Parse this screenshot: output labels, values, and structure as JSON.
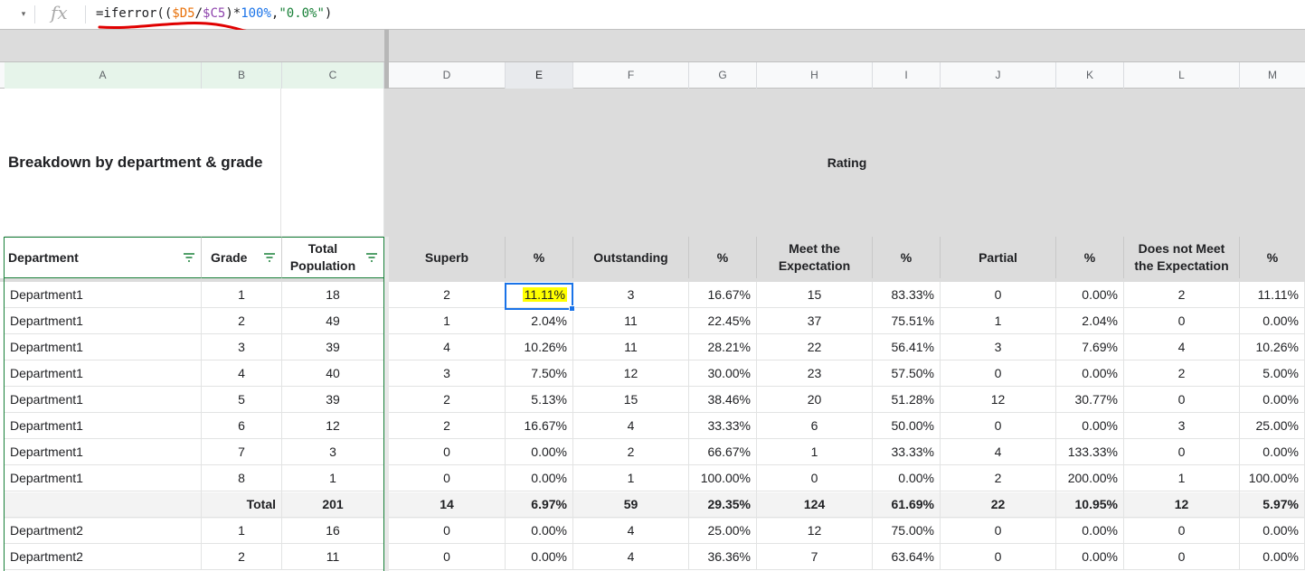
{
  "formula_bar": {
    "formula_prefix": "=iferror((",
    "ref1": "$D5",
    "slash": "/",
    "ref2": "$C5",
    "mid": ")*",
    "num": "100%",
    "comma": ",",
    "str": "\"0.0%\"",
    "suffix": ")"
  },
  "columns": [
    "A",
    "B",
    "C",
    "D",
    "E",
    "F",
    "G",
    "H",
    "I",
    "J",
    "K",
    "L",
    "M"
  ],
  "title": "Breakdown by department & grade",
  "rating_title": "Rating",
  "headers": {
    "department": "Department",
    "grade": "Grade",
    "total_population": "Total Population",
    "superb": "Superb",
    "pct1": "%",
    "outstanding": "Outstanding",
    "pct2": "%",
    "meet": "Meet the Expectation",
    "pct3": "%",
    "partial": "Partial",
    "pct4": "%",
    "does_not_meet": "Does not Meet the Expectation",
    "pct5": "%"
  },
  "rows": [
    [
      "Department1",
      "1",
      "18",
      "2",
      "11.11%",
      "3",
      "16.67%",
      "15",
      "83.33%",
      "0",
      "0.00%",
      "2",
      "11.11%"
    ],
    [
      "Department1",
      "2",
      "49",
      "1",
      "2.04%",
      "11",
      "22.45%",
      "37",
      "75.51%",
      "1",
      "2.04%",
      "0",
      "0.00%"
    ],
    [
      "Department1",
      "3",
      "39",
      "4",
      "10.26%",
      "11",
      "28.21%",
      "22",
      "56.41%",
      "3",
      "7.69%",
      "4",
      "10.26%"
    ],
    [
      "Department1",
      "4",
      "40",
      "3",
      "7.50%",
      "12",
      "30.00%",
      "23",
      "57.50%",
      "0",
      "0.00%",
      "2",
      "5.00%"
    ],
    [
      "Department1",
      "5",
      "39",
      "2",
      "5.13%",
      "15",
      "38.46%",
      "20",
      "51.28%",
      "12",
      "30.77%",
      "0",
      "0.00%"
    ],
    [
      "Department1",
      "6",
      "12",
      "2",
      "16.67%",
      "4",
      "33.33%",
      "6",
      "50.00%",
      "0",
      "0.00%",
      "3",
      "25.00%"
    ],
    [
      "Department1",
      "7",
      "3",
      "0",
      "0.00%",
      "2",
      "66.67%",
      "1",
      "33.33%",
      "4",
      "133.33%",
      "0",
      "0.00%"
    ],
    [
      "Department1",
      "8",
      "1",
      "0",
      "0.00%",
      "1",
      "100.00%",
      "0",
      "0.00%",
      "2",
      "200.00%",
      "1",
      "100.00%"
    ],
    [
      "",
      "Total",
      "201",
      "14",
      "6.97%",
      "59",
      "29.35%",
      "124",
      "61.69%",
      "22",
      "10.95%",
      "12",
      "5.97%"
    ],
    [
      "Department2",
      "1",
      "16",
      "0",
      "0.00%",
      "4",
      "25.00%",
      "12",
      "75.00%",
      "0",
      "0.00%",
      "0",
      "0.00%"
    ],
    [
      "Department2",
      "2",
      "11",
      "0",
      "0.00%",
      "4",
      "36.36%",
      "7",
      "63.64%",
      "0",
      "0.00%",
      "0",
      "0.00%"
    ]
  ],
  "colors": {
    "frozen_border": "#188038",
    "selection": "#1a73e8",
    "highlight": "#ffff00",
    "annotation": "#e00000"
  }
}
